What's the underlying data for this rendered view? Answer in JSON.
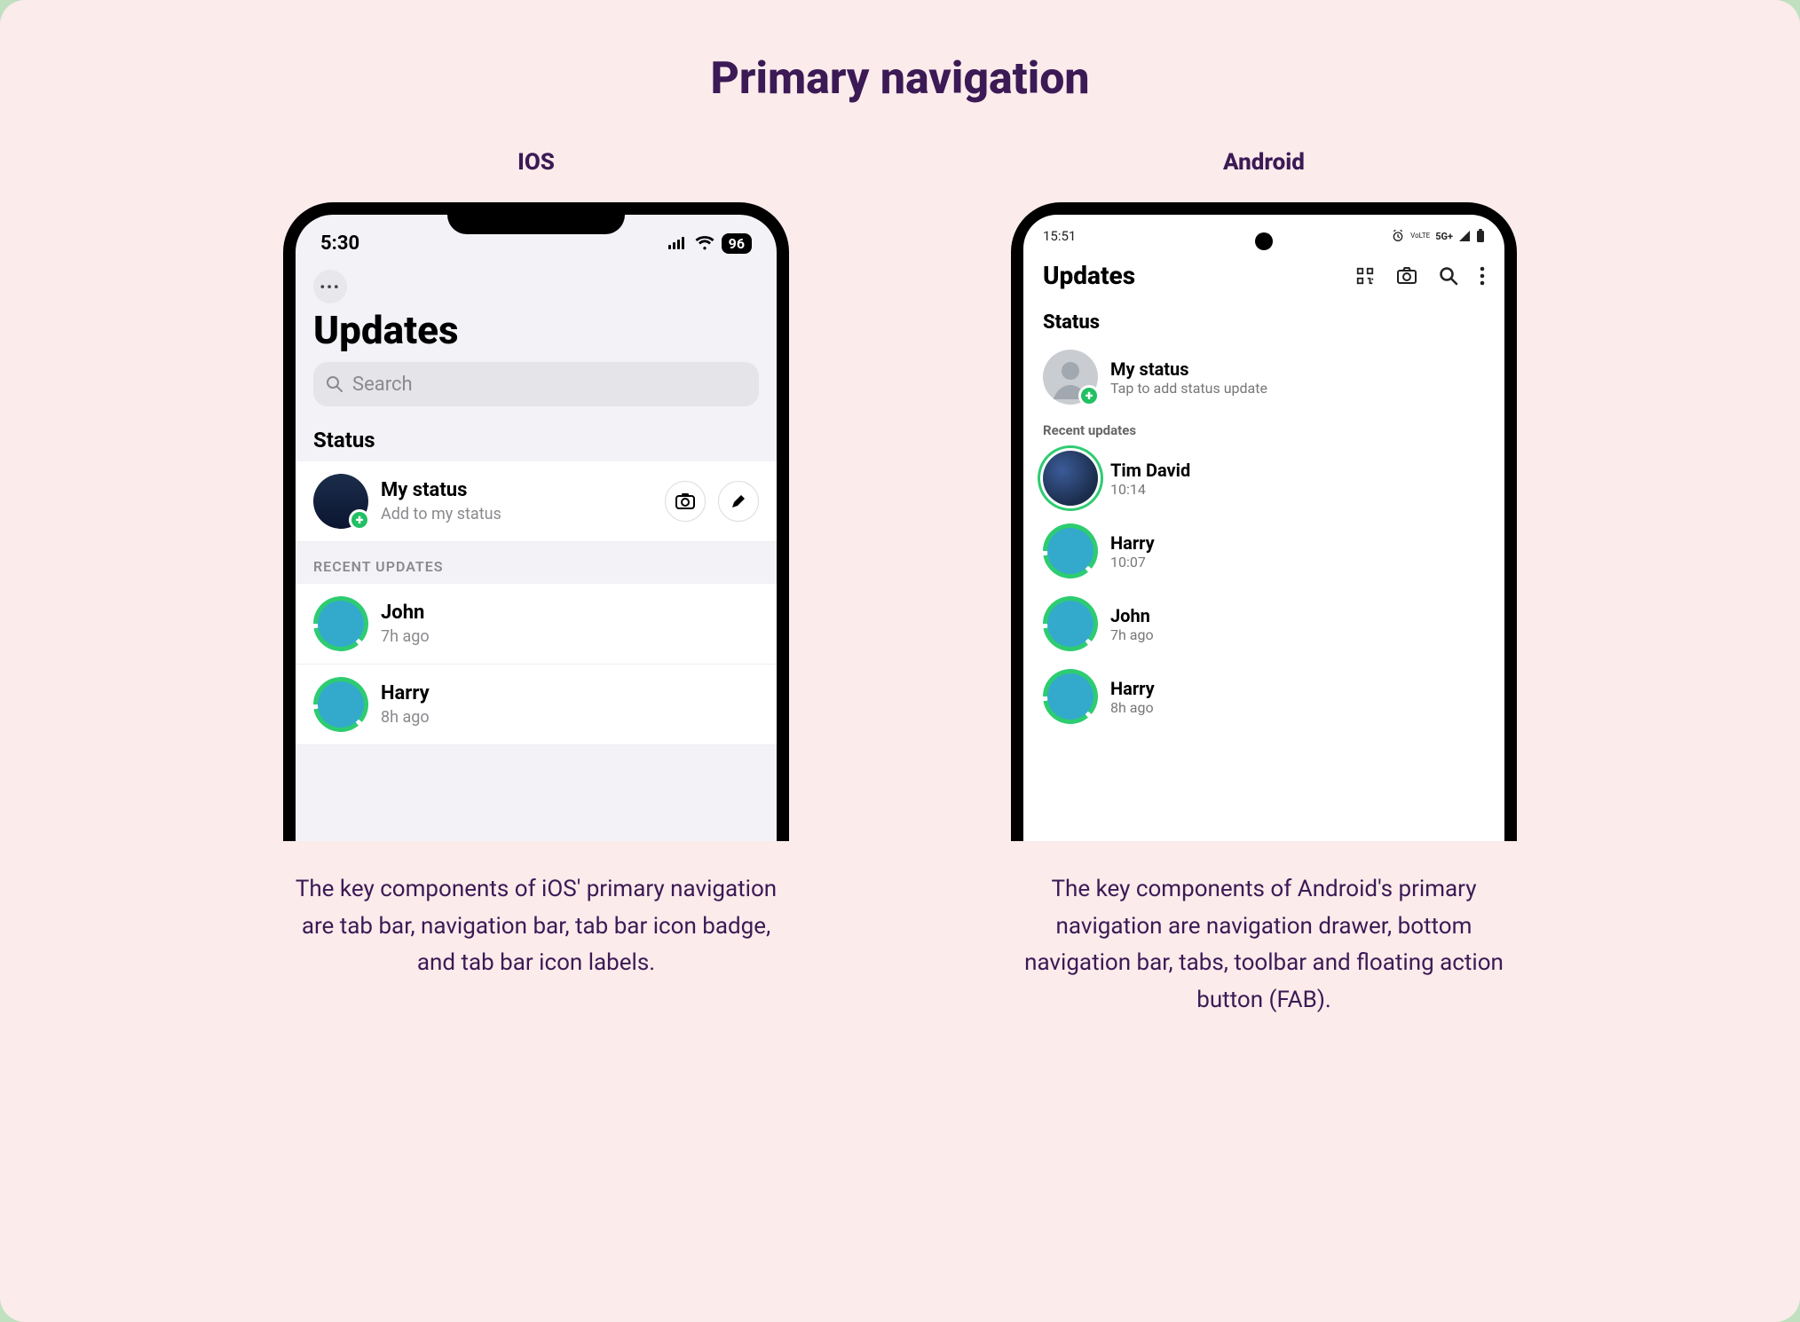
{
  "title": "Primary navigation",
  "ios": {
    "label": "IOS",
    "statusTime": "5:30",
    "battery": "96",
    "header": "Updates",
    "searchPlaceholder": "Search",
    "statusSection": "Status",
    "myStatus": {
      "name": "My status",
      "sub": "Add to my status"
    },
    "recentHeader": "RECENT UPDATES",
    "recent": [
      {
        "name": "John",
        "sub": "7h ago"
      },
      {
        "name": "Harry",
        "sub": "8h ago"
      }
    ],
    "caption": "The key components of iOS' primary navigation are tab bar, navigation bar, tab bar icon badge, and tab bar icon labels."
  },
  "android": {
    "label": "Android",
    "statusTime": "15:51",
    "networkLabel": "5G+",
    "lteLabel": "VoLTE",
    "header": "Updates",
    "statusSection": "Status",
    "myStatus": {
      "name": "My status",
      "sub": "Tap to add status update"
    },
    "recentHeader": "Recent updates",
    "recent": [
      {
        "name": "Tim David",
        "sub": "10:14"
      },
      {
        "name": "Harry",
        "sub": "10:07"
      },
      {
        "name": "John",
        "sub": "7h ago"
      },
      {
        "name": "Harry",
        "sub": "8h ago"
      }
    ],
    "caption": "The key components of Android's primary navigation are navigation drawer, bottom navigation bar, tabs, toolbar and floating action button (FAB)."
  }
}
